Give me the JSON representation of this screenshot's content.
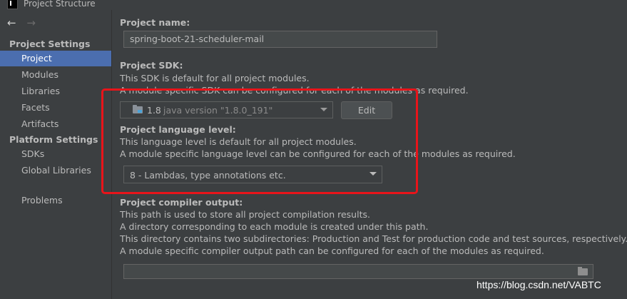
{
  "window": {
    "title": "Project Structure"
  },
  "sidebar": {
    "back_arrow": "←",
    "forward_arrow": "→",
    "project_settings_header": "Project Settings",
    "platform_settings_header": "Platform Settings",
    "items": [
      {
        "label": "Project",
        "selected": true
      },
      {
        "label": "Modules"
      },
      {
        "label": "Libraries"
      },
      {
        "label": "Facets"
      },
      {
        "label": "Artifacts"
      },
      {
        "label": "SDKs"
      },
      {
        "label": "Global Libraries"
      },
      {
        "label": "Problems"
      }
    ]
  },
  "project_name": {
    "label": "Project name:",
    "value": "spring-boot-21-scheduler-mail"
  },
  "project_sdk": {
    "label": "Project SDK:",
    "desc1": "This SDK is default for all project modules.",
    "desc2": "A module specific SDK can be configured for each of the modules as required.",
    "sdk_name": "1.8",
    "sdk_version": "java version \"1.8.0_191\"",
    "edit_button": "Edit"
  },
  "language_level": {
    "label": "Project language level:",
    "desc1": "This language level is default for all project modules.",
    "desc2": "A module specific language level can be configured for each of the modules as required.",
    "value": "8 - Lambdas, type annotations etc."
  },
  "compiler_output": {
    "label": "Project compiler output:",
    "desc1": "This path is used to store all project compilation results.",
    "desc2": "A directory corresponding to each module is created under this path.",
    "desc3": "This directory contains two subdirectories: Production and Test for production code and test sources, respectively.",
    "desc4": "A module specific compiler output path can be configured for each of the modules as required.",
    "path": ""
  },
  "watermark": "https://blog.csdn.net/VABTC",
  "colors": {
    "background": "#3c3f41",
    "selection": "#4b6eaf",
    "highlight_box": "#e8141a"
  }
}
